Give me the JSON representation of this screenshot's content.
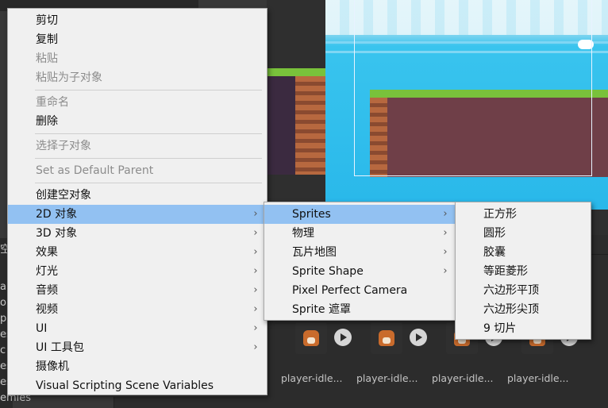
{
  "main_menu": {
    "items": [
      {
        "label": "剪切",
        "enabled": true,
        "submenu": false
      },
      {
        "label": "复制",
        "enabled": true,
        "submenu": false
      },
      {
        "label": "粘贴",
        "enabled": false,
        "submenu": false
      },
      {
        "label": "粘贴为子对象",
        "enabled": false,
        "submenu": false
      },
      {
        "label": "重命名",
        "enabled": false,
        "submenu": false
      },
      {
        "label": "删除",
        "enabled": true,
        "submenu": false
      },
      {
        "label": "选择子对象",
        "enabled": false,
        "submenu": false
      },
      {
        "label": "Set as Default Parent",
        "enabled": false,
        "submenu": false
      },
      {
        "label": "创建空对象",
        "enabled": true,
        "submenu": false
      },
      {
        "label": "2D 对象",
        "enabled": true,
        "submenu": true,
        "highlighted": true
      },
      {
        "label": "3D 对象",
        "enabled": true,
        "submenu": true
      },
      {
        "label": "效果",
        "enabled": true,
        "submenu": true
      },
      {
        "label": "灯光",
        "enabled": true,
        "submenu": true
      },
      {
        "label": "音频",
        "enabled": true,
        "submenu": true
      },
      {
        "label": "视频",
        "enabled": true,
        "submenu": true
      },
      {
        "label": "UI",
        "enabled": true,
        "submenu": true
      },
      {
        "label": "UI 工具包",
        "enabled": true,
        "submenu": true
      },
      {
        "label": "摄像机",
        "enabled": true,
        "submenu": false
      },
      {
        "label": "Visual Scripting Scene Variables",
        "enabled": true,
        "submenu": false
      }
    ]
  },
  "submenu_2d": {
    "items": [
      {
        "label": "Sprites",
        "submenu": true,
        "highlighted": true
      },
      {
        "label": "物理",
        "submenu": true
      },
      {
        "label": "瓦片地图",
        "submenu": true
      },
      {
        "label": "Sprite Shape",
        "submenu": true
      },
      {
        "label": "Pixel Perfect Camera",
        "submenu": false
      },
      {
        "label": "Sprite 遮罩",
        "submenu": false
      }
    ]
  },
  "submenu_sprites": {
    "items": [
      {
        "label": "正方形"
      },
      {
        "label": "圆形"
      },
      {
        "label": "胶囊"
      },
      {
        "label": "等距菱形"
      },
      {
        "label": "六边形平顶"
      },
      {
        "label": "六边形尖顶"
      },
      {
        "label": "9 切片"
      }
    ]
  },
  "assets": {
    "labels": [
      "player-idle...",
      "player-idle...",
      "player-idle...",
      "player-idle..."
    ]
  },
  "hierarchy_fragments": {
    "top": "空",
    "rows": [
      "ar",
      "o",
      "p",
      "es",
      "c",
      "es",
      "es"
    ],
    "bottom": "emies"
  },
  "colors": {
    "highlight": "#92c1f2",
    "menu_bg": "#f0f0f0",
    "disabled_text": "#8c8c8c"
  }
}
